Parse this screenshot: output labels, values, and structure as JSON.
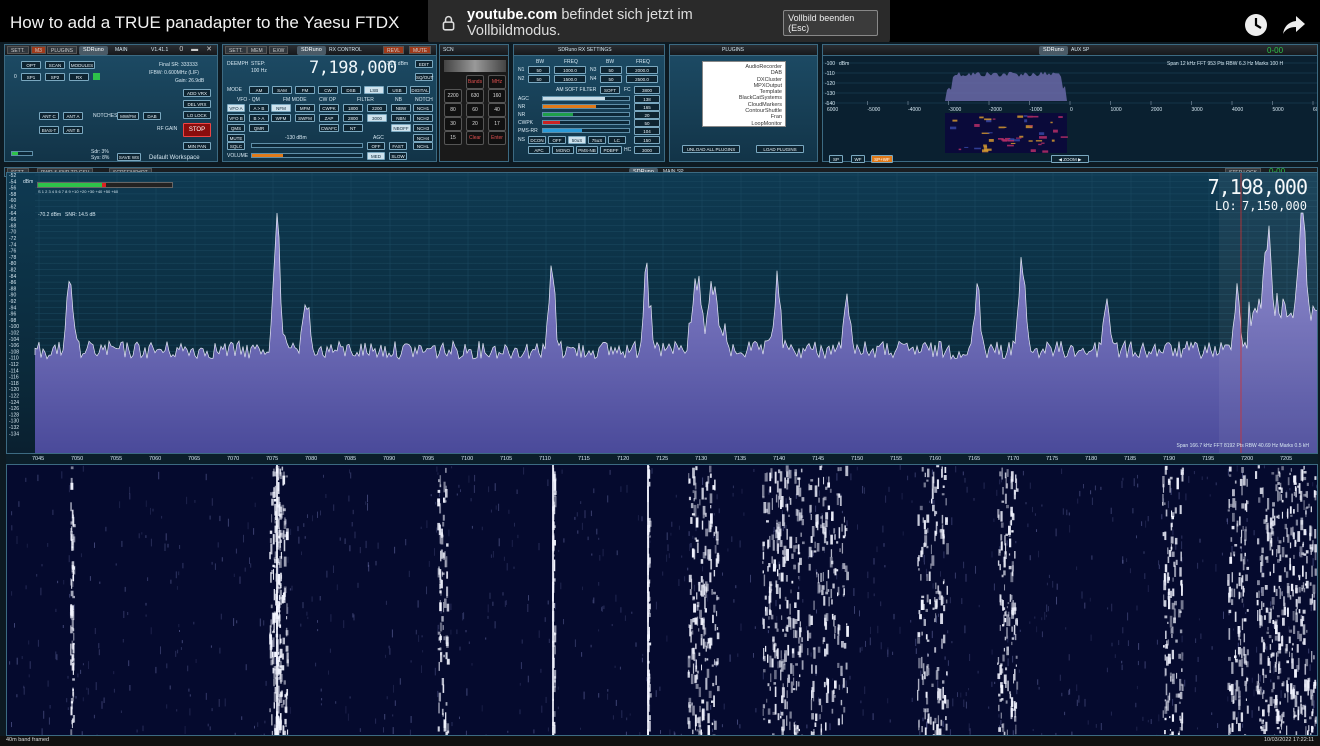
{
  "youtube": {
    "video_title": "How to add a TRUE panadapter to the Yaesu FTDX",
    "fullscreen_domain": "youtube.com",
    "fullscreen_message": "befindet sich jetzt im Vollbildmodus.",
    "exit_fullscreen": "Vollbild beenden (Esc)",
    "icons": [
      "clock-icon",
      "share-icon",
      "lock-icon"
    ]
  },
  "sdr": {
    "brand": "SDRuno",
    "main_panel": {
      "title": "MAIN",
      "version": "V1.41.1",
      "buttons": [
        "SETT.",
        "M3",
        "PLUGINS",
        "OPT",
        "SCAN",
        "MODULES",
        "SP1",
        "SP2",
        "RX",
        "ANT C",
        "ANT A",
        "BIAS-T",
        "ANT B",
        "ADD VRX",
        "DEL VRX",
        "LO LOCK",
        "STOP",
        "MIN PAN",
        "SAVE WS"
      ],
      "notches_label": "NOTCHES",
      "notch_buttons": [
        "MW/FM",
        "DAB"
      ],
      "rf_gain_label": "RF GAIN",
      "final_sr": "Final SR: 333333",
      "ifbw": "IFBW: 0.600MHz (LIF)",
      "gain": "Gain: 26.9dB",
      "sdr_stat": "Sdr: 3%",
      "sys_stat": "Sys: 8%",
      "workspace": "Default Workspace",
      "zero": "0"
    },
    "rx_control": {
      "title": "RX CONTROL",
      "tab_buttons": [
        "SETT.",
        "MEM",
        "EXW",
        "REVL",
        "MUTE"
      ],
      "deemph": "DEEMPH",
      "step_label": "STEP:",
      "step_value": "100 Hz",
      "frequency": "7,198,000",
      "level": "-70.2 dBm",
      "mode_label": "MODE",
      "modes": [
        "AM",
        "SAM",
        "FM",
        "CW",
        "DSB",
        "LSB",
        "USB",
        "DIGITAL"
      ],
      "fm_mode_label": "FM MODE",
      "cw_op_label": "CW OP",
      "filter_label": "FILTER",
      "nb_label": "NB",
      "notch_label": "NOTCH",
      "vfo_label": "VFO - QM",
      "buttons_row1": [
        "VFO A",
        "A > B",
        "NFM",
        "MFM",
        "CWPK",
        "1800",
        "2200",
        "NBW",
        "NCH1"
      ],
      "buttons_row2": [
        "VFO B",
        "B > A",
        "WFM",
        "SWFM",
        "ZAP",
        "2800",
        "3000",
        "NBN",
        "NCH2"
      ],
      "buttons_row3": [
        "QMS",
        "QMR",
        "CWAFC",
        "NT",
        "NBOFF",
        "NCH3"
      ],
      "buttons_row4": [
        "MUTE",
        "NCH4"
      ],
      "sqlc": "SQLC",
      "squelch_db": "-130 dBm",
      "agc_label": "AGC",
      "agc_buttons": [
        "OFF",
        "FAST",
        "MED",
        "SLOW"
      ],
      "nchl": "NCHL",
      "volume_label": "VOLUME",
      "edit": "EDIT",
      "squelch_label": "SQ/OUT",
      "volume_fraction": 0.28
    },
    "keypad": {
      "title": "SCN",
      "keys": [
        "Bands",
        "MHz",
        "2200",
        "630",
        "160",
        "80",
        "60",
        "40",
        "30",
        "20",
        "17",
        "15",
        "Clear",
        "Enter"
      ]
    },
    "rx_settings": {
      "title": "SDRuno RX SETTINGS",
      "headers": [
        "BW",
        "FREQ",
        "BW",
        "FREQ"
      ],
      "n1_label": "N1",
      "n2_label": "N2",
      "n3_label": "N3",
      "n4_label": "N4",
      "n1": [
        "50",
        "1000.0"
      ],
      "n2": [
        "50",
        "1500.0"
      ],
      "n3": [
        "50",
        "2000.0"
      ],
      "n4": [
        "50",
        "2500.0"
      ],
      "am_soft_filter": "AM SOFT FILTER",
      "soft": "SOFT",
      "fc_label": "FC",
      "fc_value": "3800",
      "rows": [
        {
          "label": "AGC",
          "value": "138",
          "fill": 0.72,
          "color": "#c9dde8"
        },
        {
          "label": "NR",
          "value": "165",
          "fill": 0.62,
          "color": "#e07a1a"
        },
        {
          "label": "NR",
          "value": "20",
          "fill": 0.35,
          "color": "#1fa04a"
        },
        {
          "label": "CWPK",
          "value": "50",
          "fill": 0.2,
          "color": "#cc2222"
        },
        {
          "label": "PMS-RR",
          "value": "104",
          "fill": 0.45,
          "color": "#2a9ad8"
        }
      ],
      "ns_buttons": [
        "DCON",
        "OFF",
        "50uS",
        "75uS",
        "LC"
      ],
      "ns_label": "NS",
      "lc_value": "150",
      "apc_buttons": [
        "APC",
        "MONO",
        "PMS-NB",
        "PDBPF"
      ],
      "hc_label": "HC",
      "hc_value": "3000"
    },
    "plugins": {
      "title": "PLUGINS",
      "items": [
        "AudioRecorder",
        "DAB",
        "DXCluster",
        "MPXOutput",
        "Template",
        "BlackCatSystems",
        "CloudMarkers",
        "ContourShuttle",
        "Fran",
        "LoopMonitor"
      ],
      "unload": "UNLOAD ALL PLUGINS",
      "load": "LOAD PLUGINS"
    },
    "aux_sp": {
      "title": "AUX SP",
      "dbm_label": "dBm",
      "y_ticks": [
        "-100",
        "-110",
        "-120",
        "-130",
        "-140"
      ],
      "x_ticks": [
        "6000",
        "-5000",
        "-4000",
        "-3000",
        "-2000",
        "-1000",
        "0",
        "1000",
        "2000",
        "3000",
        "4000",
        "5000",
        "60"
      ],
      "info": "Span 12 kHz  FFT 953 Pts  RBW 6.3 Hz  Marks 100 H",
      "buttons": [
        "SP",
        "WF",
        "SP+WF"
      ],
      "zoom": "ZOOM",
      "freq_display": "0-00"
    },
    "main_sp": {
      "title": "MAIN SP",
      "tab_buttons": [
        "SETT.",
        "PWR & SNR TO CSV",
        "SCREENSHOT",
        "STEP LOCK"
      ],
      "dbm_label": "dBm",
      "y_ticks": [
        "-52",
        "-54",
        "-56",
        "-58",
        "-60",
        "-62",
        "-64",
        "-66",
        "-68",
        "-70",
        "-72",
        "-74",
        "-76",
        "-78",
        "-80",
        "-82",
        "-84",
        "-86",
        "-88",
        "-90",
        "-92",
        "-94",
        "-96",
        "-98",
        "-100",
        "-102",
        "-104",
        "-106",
        "-108",
        "-110",
        "-112",
        "-114",
        "-116",
        "-118",
        "-120",
        "-122",
        "-124",
        "-126",
        "-128",
        "-130",
        "-132",
        "-134"
      ],
      "smeter_scale": "S  1  2  3  4  5  6  7  8  9  +10  +20  +30  +40  +50  +60",
      "signal_level": "-70.2 dBm",
      "snr": "SNR: 14.5 dB",
      "vfo_frequency": "7,198,000",
      "lo_label": "LO:",
      "lo_frequency": "7,150,000",
      "info": "Span 166.7 kHz  FFT 8192 Pts  RBW 40.69 Hz  Marks 0.5 kH",
      "x_ticks": [
        "7045",
        "7050",
        "7055",
        "7060",
        "7065",
        "7070",
        "7075",
        "7080",
        "7085",
        "7090",
        "7095",
        "7100",
        "7105",
        "7110",
        "7115",
        "7120",
        "7125",
        "7130",
        "7135",
        "7140",
        "7145",
        "7150",
        "7155",
        "7160",
        "7165",
        "7170",
        "7175",
        "7180",
        "7185",
        "7190",
        "7195",
        "7200",
        "7205"
      ],
      "freq_display": "0-00"
    },
    "status": {
      "left": "40m band framed",
      "right": "10/03/2022 17:22:11"
    }
  }
}
